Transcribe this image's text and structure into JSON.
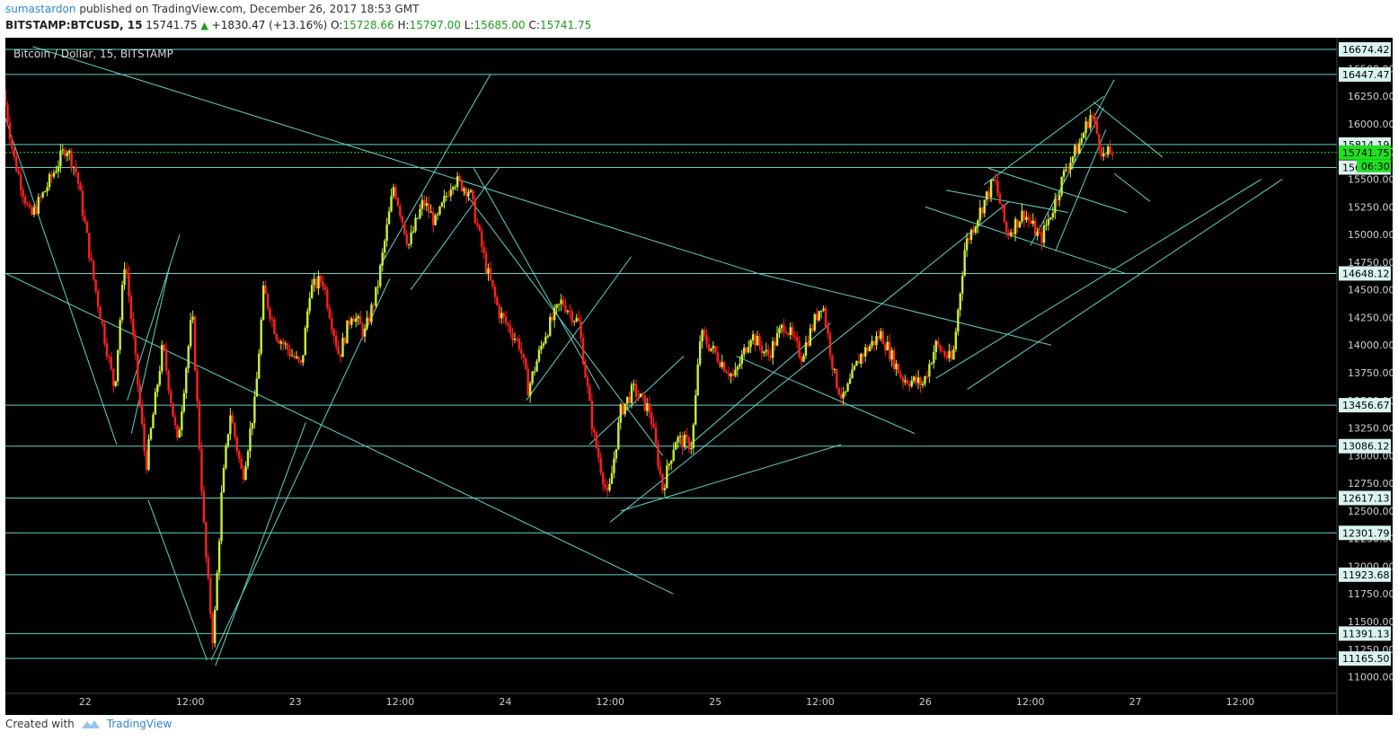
{
  "header": {
    "author": "sumastardon",
    "published": "published on TradingView.com, December 26, 2017 18:53 GMT",
    "symbol": "BITSTAMP:BTCUSD, 15",
    "last": "15741.75",
    "change": "+1830.47 (+13.16%)",
    "open_label": "O:",
    "open": "15728.66",
    "high_label": "H:",
    "high": "15797.00",
    "low_label": "L:",
    "low": "15685.00",
    "close_label": "C:",
    "close": "15741.75"
  },
  "footer": {
    "created_with": "Created with",
    "brand": "TradingView"
  },
  "colors": {
    "background": "#000000",
    "up": "#c8f03c",
    "down": "#ff2020",
    "line": "#5fd3c6",
    "price_tag": "#20e020"
  },
  "chart_data": {
    "type": "candlestick",
    "title": "Bitcoin / Dollar, 15, BITSTAMP",
    "ylim": [
      10850,
      16780
    ],
    "yticks": [
      11000,
      11250,
      11500,
      11750,
      12000,
      12250,
      12500,
      12750,
      13000,
      13250,
      13500,
      13750,
      14000,
      14250,
      14500,
      14750,
      15000,
      15250,
      15500,
      15750,
      16000,
      16250,
      16500
    ],
    "x_labels": [
      "22",
      "12:00",
      "23",
      "12:00",
      "24",
      "12:00",
      "25",
      "12:00",
      "26",
      "12:00",
      "27",
      "12:00"
    ],
    "x_label_values": [
      1,
      1.5,
      2,
      2.5,
      3,
      3.5,
      4,
      4.5,
      5,
      5.5,
      6,
      6.5
    ],
    "xlim": [
      0.62,
      6.96
    ],
    "horizontal_levels": [
      16674.42,
      16447.47,
      15814.19,
      15606.3,
      14648.12,
      13456.67,
      13086.12,
      12617.13,
      12301.79,
      11923.68,
      11391.13,
      11165.5
    ],
    "last_price": 15741.75,
    "countdown": "06:30",
    "path": [
      [
        0.62,
        16300
      ],
      [
        0.67,
        15700
      ],
      [
        0.75,
        15150
      ],
      [
        0.82,
        15400
      ],
      [
        0.92,
        15800
      ],
      [
        0.97,
        15550
      ],
      [
        1.05,
        14600
      ],
      [
        1.15,
        13600
      ],
      [
        1.2,
        14800
      ],
      [
        1.3,
        12900
      ],
      [
        1.38,
        14000
      ],
      [
        1.45,
        13100
      ],
      [
        1.52,
        14300
      ],
      [
        1.58,
        12200
      ],
      [
        1.62,
        11300
      ],
      [
        1.66,
        12650
      ],
      [
        1.7,
        13400
      ],
      [
        1.76,
        12800
      ],
      [
        1.82,
        13500
      ],
      [
        1.86,
        14500
      ],
      [
        1.92,
        14100
      ],
      [
        2.04,
        13800
      ],
      [
        2.08,
        14500
      ],
      [
        2.14,
        14600
      ],
      [
        2.22,
        13900
      ],
      [
        2.28,
        14300
      ],
      [
        2.34,
        14100
      ],
      [
        2.4,
        14500
      ],
      [
        2.48,
        15450
      ],
      [
        2.55,
        14900
      ],
      [
        2.62,
        15300
      ],
      [
        2.68,
        15100
      ],
      [
        2.76,
        15500
      ],
      [
        2.84,
        15400
      ],
      [
        2.92,
        14700
      ],
      [
        2.98,
        14300
      ],
      [
        3.08,
        14000
      ],
      [
        3.12,
        13600
      ],
      [
        3.2,
        14100
      ],
      [
        3.28,
        14400
      ],
      [
        3.36,
        14200
      ],
      [
        3.43,
        13200
      ],
      [
        3.5,
        12600
      ],
      [
        3.56,
        13400
      ],
      [
        3.62,
        13600
      ],
      [
        3.7,
        13400
      ],
      [
        3.76,
        12700
      ],
      [
        3.82,
        13150
      ],
      [
        3.9,
        13100
      ],
      [
        3.94,
        14100
      ],
      [
        4.02,
        13900
      ],
      [
        4.1,
        13700
      ],
      [
        4.18,
        14100
      ],
      [
        4.26,
        13900
      ],
      [
        4.34,
        14200
      ],
      [
        4.42,
        13900
      ],
      [
        4.52,
        14400
      ],
      [
        4.58,
        13700
      ],
      [
        4.62,
        13500
      ],
      [
        4.7,
        13900
      ],
      [
        4.8,
        14100
      ],
      [
        4.9,
        13700
      ],
      [
        5.0,
        13650
      ],
      [
        5.06,
        14000
      ],
      [
        5.14,
        13850
      ],
      [
        5.2,
        14900
      ],
      [
        5.28,
        15250
      ],
      [
        5.34,
        15500
      ],
      [
        5.4,
        15000
      ],
      [
        5.48,
        15200
      ],
      [
        5.56,
        14950
      ],
      [
        5.62,
        15250
      ],
      [
        5.68,
        15600
      ],
      [
        5.74,
        15800
      ],
      [
        5.8,
        16100
      ],
      [
        5.86,
        15700
      ],
      [
        5.9,
        15750
      ]
    ]
  }
}
